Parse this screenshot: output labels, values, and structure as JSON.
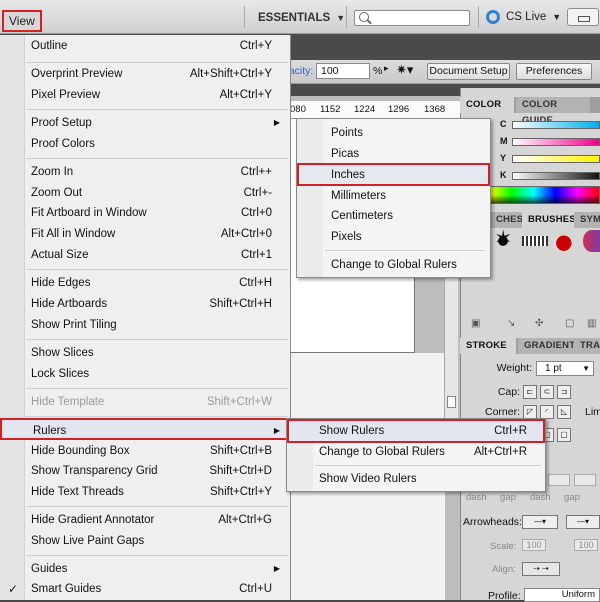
{
  "appbar": {
    "view_menu": "View",
    "workspace": "ESSENTIALS",
    "cs_live": "CS Live"
  },
  "control": {
    "opacity_label": "pacity:",
    "opacity_value": "100",
    "pct": "%",
    "doc_setup": "Document Setup",
    "preferences": "Preferences"
  },
  "ruler_ticks": [
    "080",
    "1152",
    "1224",
    "1296",
    "1368"
  ],
  "panels": {
    "color_tab": "COLOR",
    "color_guide_tab": "COLOR GUIDE",
    "channels": [
      "C",
      "M",
      "Y",
      "K"
    ],
    "swatches_tab": "CHES",
    "brushes_tab": "BRUSHES",
    "symbols_tab": "SYMB",
    "stroke_tab": "STROKE",
    "gradient_tab": "GRADIENT",
    "transparency_tab": "TRAN",
    "weight_label": "Weight:",
    "weight_value": "1 pt",
    "cap_label": "Cap:",
    "corner_label": "Corner:",
    "limit_label": "Lim",
    "dash_labels": [
      "dash",
      "gap",
      "dash",
      "gap",
      "dash",
      "gap"
    ],
    "arrowheads_label": "Arrowheads:",
    "scale_label": "Scale:",
    "scale_values": [
      "100",
      "100"
    ],
    "align_label": "Align:",
    "profile_label": "Profile:",
    "profile_value": "Uniform"
  },
  "view_menu": {
    "items": [
      {
        "label": "Outline",
        "shortcut": "Ctrl+Y"
      },
      {
        "label": "Overprint Preview",
        "shortcut": "Alt+Shift+Ctrl+Y"
      },
      {
        "label": "Pixel Preview",
        "shortcut": "Alt+Ctrl+Y"
      },
      {
        "label": "Proof Setup",
        "shortcut": ""
      },
      {
        "label": "Proof Colors",
        "shortcut": ""
      },
      {
        "label": "Zoom In",
        "shortcut": "Ctrl++"
      },
      {
        "label": "Zoom Out",
        "shortcut": "Ctrl+-"
      },
      {
        "label": "Fit Artboard in Window",
        "shortcut": "Ctrl+0"
      },
      {
        "label": "Fit All in Window",
        "shortcut": "Alt+Ctrl+0"
      },
      {
        "label": "Actual Size",
        "shortcut": "Ctrl+1"
      },
      {
        "label": "Hide Edges",
        "shortcut": "Ctrl+H"
      },
      {
        "label": "Hide Artboards",
        "shortcut": "Shift+Ctrl+H"
      },
      {
        "label": "Show Print Tiling",
        "shortcut": ""
      },
      {
        "label": "Show Slices",
        "shortcut": ""
      },
      {
        "label": "Lock Slices",
        "shortcut": ""
      },
      {
        "label": "Hide Template",
        "shortcut": "Shift+Ctrl+W"
      },
      {
        "label": "Rulers",
        "shortcut": ""
      },
      {
        "label": "Hide Bounding Box",
        "shortcut": "Shift+Ctrl+B"
      },
      {
        "label": "Show Transparency Grid",
        "shortcut": "Shift+Ctrl+D"
      },
      {
        "label": "Hide Text Threads",
        "shortcut": "Shift+Ctrl+Y"
      },
      {
        "label": "Hide Gradient Annotator",
        "shortcut": "Alt+Ctrl+G"
      },
      {
        "label": "Show Live Paint Gaps",
        "shortcut": ""
      },
      {
        "label": "Guides",
        "shortcut": ""
      },
      {
        "label": "Smart Guides",
        "shortcut": "Ctrl+U"
      }
    ]
  },
  "units_menu": {
    "items": [
      "Points",
      "Picas",
      "Inches",
      "Millimeters",
      "Centimeters",
      "Pixels",
      "Change to Global Rulers"
    ]
  },
  "rulers_menu": {
    "items": [
      {
        "label": "Show Rulers",
        "shortcut": "Ctrl+R"
      },
      {
        "label": "Change to Global Rulers",
        "shortcut": "Alt+Ctrl+R"
      },
      {
        "label": "Show Video Rulers",
        "shortcut": ""
      }
    ]
  },
  "colors": {
    "highlight_border": "#d32027",
    "cs_live_ring": "#2c83d6"
  }
}
